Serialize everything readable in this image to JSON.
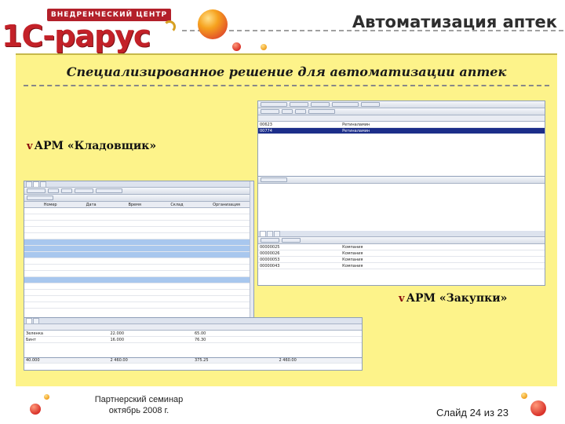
{
  "header": {
    "logo_tag": "ВНЕДРЕНЧЕСКИЙ ЦЕНТР",
    "logo_text": "1С-рарус",
    "title": "Автоматизация аптек"
  },
  "subtitle": "Специализированное решение для автоматизации аптек",
  "bullets": [
    {
      "marker": "v",
      "text": "АРМ «Кладовщик»"
    },
    {
      "marker": "v",
      "text": "АРМ «Закупки»"
    }
  ],
  "screens": {
    "win_a": {
      "rows": [
        {
          "code": "00623",
          "name": "Ретиналамин"
        },
        {
          "code": "00774",
          "name": "Ретиналамин"
        }
      ]
    },
    "win_b": {
      "rows": [
        {
          "code": "00000025",
          "name": "Компания"
        },
        {
          "code": "00000026",
          "name": "Компания"
        },
        {
          "code": "00000053",
          "name": "Компания"
        },
        {
          "code": "00000043",
          "name": "Компания"
        }
      ]
    },
    "win_c": {
      "headers": [
        "Номер",
        "Дата",
        "Время",
        "Склад",
        "Организация"
      ],
      "rows": [
        {
          "kind": "normal"
        },
        {
          "kind": "normal"
        },
        {
          "kind": "normal"
        },
        {
          "kind": "normal"
        },
        {
          "kind": "normal"
        },
        {
          "kind": "sel"
        },
        {
          "kind": "sel"
        },
        {
          "kind": "sel"
        },
        {
          "kind": "normal"
        },
        {
          "kind": "normal"
        },
        {
          "kind": "normal"
        },
        {
          "kind": "sel"
        },
        {
          "kind": "normal"
        },
        {
          "kind": "normal"
        },
        {
          "kind": "normal"
        },
        {
          "kind": "normal"
        }
      ],
      "total_a": "40.000",
      "total_b": "2 460.00",
      "total_c": "375.25",
      "total_d": "2 460.00"
    },
    "win_d": {
      "rows": [
        {
          "name": "Зеленка",
          "qty": "22.000",
          "price": "65.00"
        },
        {
          "name": "Бинт",
          "qty": "16.000",
          "price": "76.30"
        }
      ]
    }
  },
  "footer": {
    "line1": "Партнерский семинар",
    "line2": "октябрь 2008 г.",
    "slide": "Слайд 24 из 23"
  }
}
